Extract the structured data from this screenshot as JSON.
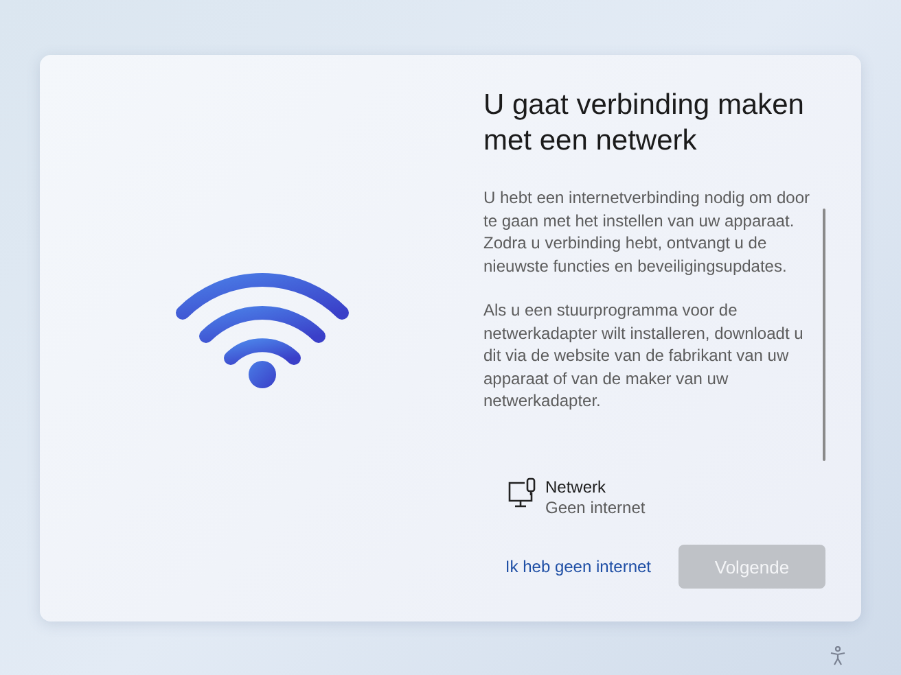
{
  "title": "U gaat verbinding maken met een netwerk",
  "paragraphs": [
    "U hebt een internetverbinding nodig om door te gaan met het instellen van uw apparaat. Zodra u verbinding hebt, ontvangt u de nieuwste functies en beveiligingsupdates.",
    "Als u een stuurprogramma voor de netwerkadapter wilt installeren, downloadt u dit via de website van de fabrikant van uw apparaat of van de maker van uw netwerkadapter."
  ],
  "network": {
    "name": "Netwerk",
    "status": "Geen internet"
  },
  "skip_link": "Ik heb geen internet",
  "next_button": {
    "label": "Volgende",
    "disabled": true
  }
}
